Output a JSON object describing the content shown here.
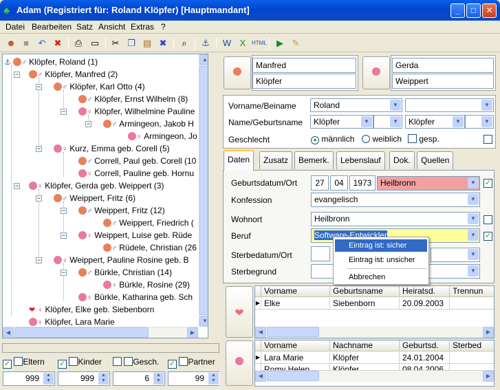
{
  "window": {
    "title": "Adam (Registriert für: Roland Klöpfer) [Hauptmandant]"
  },
  "menu": [
    "Datei",
    "Bearbeiten",
    "Satz",
    "Ansicht",
    "Extras",
    "?"
  ],
  "tree": {
    "nodes": [
      {
        "label": "Klöpfer, Roland (1)"
      },
      {
        "label": "Klöpfer, Manfred (2)"
      },
      {
        "label": "Klöpfer, Karl Otto (4)"
      },
      {
        "label": "Klöpfer, Ernst Wilhelm (8)"
      },
      {
        "label": "Klöpfer, Wilhelmine Pauline"
      },
      {
        "label": "Armingeon, Jakob H"
      },
      {
        "label": "Armingeon, Jo"
      },
      {
        "label": "Kurz, Emma geb. Corell (5)"
      },
      {
        "label": "Correll, Paul geb. Corell (10"
      },
      {
        "label": "Correll, Pauline geb. Hornu"
      },
      {
        "label": "Klöpfer, Gerda geb. Weippert (3)"
      },
      {
        "label": "Weippert, Fritz (6)"
      },
      {
        "label": "Weippert, Fritz (12)"
      },
      {
        "label": "Weippert, Friedrich ("
      },
      {
        "label": "Weippert, Luise geb. Rüde"
      },
      {
        "label": "Rüdele, Christian (26"
      },
      {
        "label": "Weippert, Pauline Rosine geb. B"
      },
      {
        "label": "Bürkle, Christian (14)"
      },
      {
        "label": "Bürkle, Rosine (29)"
      },
      {
        "label": "Bürkle, Katharina geb. Sch"
      },
      {
        "label": "Klöpfer, Elke geb. Siebenborn"
      },
      {
        "label": "Klöpfer, Lara Marie"
      }
    ]
  },
  "filters": {
    "eltern": "Eltern",
    "kinder": "Kinder",
    "gesch": "Gesch.",
    "partner": "Partner",
    "spin1": "999",
    "spin2": "999",
    "spin3": "6",
    "spin4": "99"
  },
  "parents": {
    "father_first": "Manfred",
    "father_last": "Klöpfer",
    "mother_first": "Gerda",
    "mother_last": "Weippert"
  },
  "person": {
    "label_vorname": "Vorname/Beiname",
    "vorname": "Roland",
    "label_name": "Name/Geburtsname",
    "name": "Klöpfer",
    "geburtsname": "Klöpfer",
    "label_geschlecht": "Geschlecht",
    "maennlich": "männlich",
    "weiblich": "weiblich",
    "gesp": "gesp."
  },
  "tabs": [
    "Daten",
    "Zusatz",
    "Bemerk.",
    "Lebenslauf",
    "Dok.",
    "Quellen"
  ],
  "daten": {
    "label_geburt": "Geburtsdatum/Ort",
    "day": "27",
    "month": "04",
    "year": "1973",
    "ort": "Heilbronn",
    "label_konfession": "Konfession",
    "konfession": "evangelisch",
    "label_wohnort": "Wohnort",
    "wohnort": "Heilbronn",
    "label_beruf": "Beruf",
    "beruf": "Software-Entwickler",
    "label_sterbe": "Sterbedatum/Ort",
    "label_sterbegrund": "Sterbegrund"
  },
  "context_menu": [
    "Eintrag ist: sicher",
    "Eintrag ist: unsicher",
    "Abbrechen"
  ],
  "partner_grid": {
    "headers": [
      "Vorname",
      "Geburtsname",
      "Heiratsd.",
      "Trennun"
    ],
    "rows": [
      [
        "Elke",
        "Siebenborn",
        "20.09.2003",
        ""
      ]
    ]
  },
  "children_grid": {
    "headers": [
      "Vorname",
      "Nachname",
      "Geburtsd.",
      "Sterbed"
    ],
    "rows": [
      [
        "Lara Marie",
        "Klöpfer",
        "24.01.2004",
        ""
      ],
      [
        "Romy Helen",
        "Klöpfer",
        "08.04.2006",
        ""
      ]
    ]
  },
  "colors": {
    "accent": "#0a5fe8",
    "highlight": "#316ac5",
    "ort_bg": "#f4a0a0",
    "beruf_bg": "#ffff99"
  }
}
